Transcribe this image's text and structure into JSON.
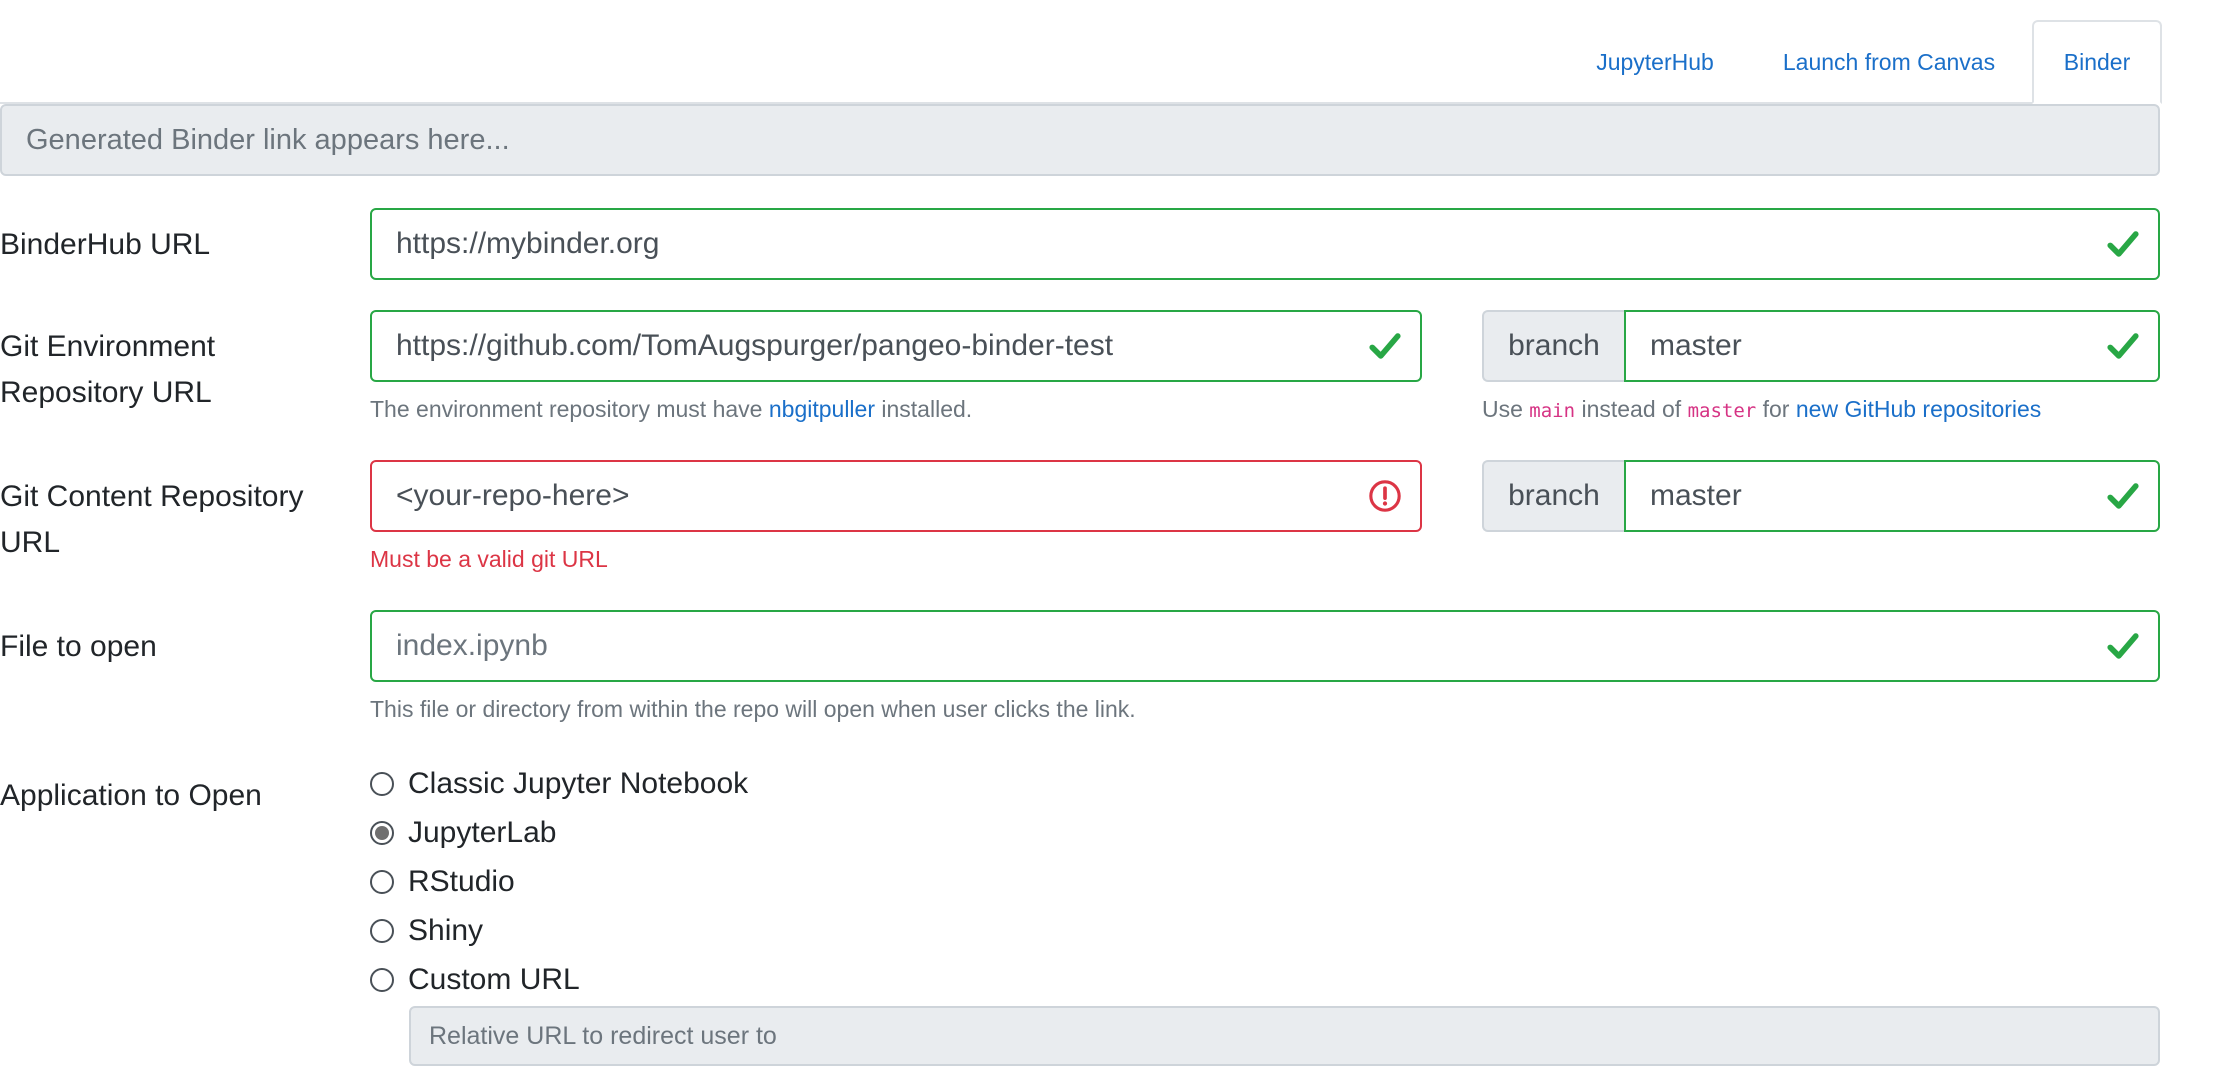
{
  "tabs": [
    {
      "label": "JupyterHub",
      "active": false
    },
    {
      "label": "Launch from Canvas",
      "active": false
    },
    {
      "label": "Binder",
      "active": true
    }
  ],
  "generated_link": {
    "placeholder": "Generated Binder link appears here..."
  },
  "binderhub": {
    "label": "BinderHub URL",
    "value": "https://mybinder.org"
  },
  "env_repo": {
    "label_line1": "Git Environment",
    "label_line2": "Repository URL",
    "value": "https://github.com/TomAugspurger/pangeo-binder-test",
    "help_prefix": "The environment repository must have ",
    "help_link": "nbgitpuller",
    "help_suffix": " installed.",
    "branch_label": "branch",
    "branch_value": "master",
    "branch_help": {
      "t1": "Use ",
      "code1": "main",
      "t2": " instead of ",
      "code2": "master",
      "t3": " for ",
      "link": "new GitHub repositories"
    }
  },
  "content_repo": {
    "label_line1": "Git Content Repository",
    "label_line2": "URL",
    "value": "<your-repo-here>",
    "error": "Must be a valid git URL",
    "branch_label": "branch",
    "branch_value": "master"
  },
  "file_to_open": {
    "label": "File to open",
    "placeholder": "index.ipynb",
    "help": "This file or directory from within the repo will open when user clicks the link."
  },
  "application": {
    "label": "Application to Open",
    "options": [
      {
        "label": "Classic Jupyter Notebook",
        "checked": false
      },
      {
        "label": "JupyterLab",
        "checked": true
      },
      {
        "label": "RStudio",
        "checked": false
      },
      {
        "label": "Shiny",
        "checked": false
      },
      {
        "label": "Custom URL",
        "checked": false
      }
    ],
    "custom_url_placeholder": "Relative URL to redirect user to"
  },
  "colors": {
    "valid": "#28a745",
    "invalid": "#dc3545",
    "link": "#1a6fc9"
  }
}
